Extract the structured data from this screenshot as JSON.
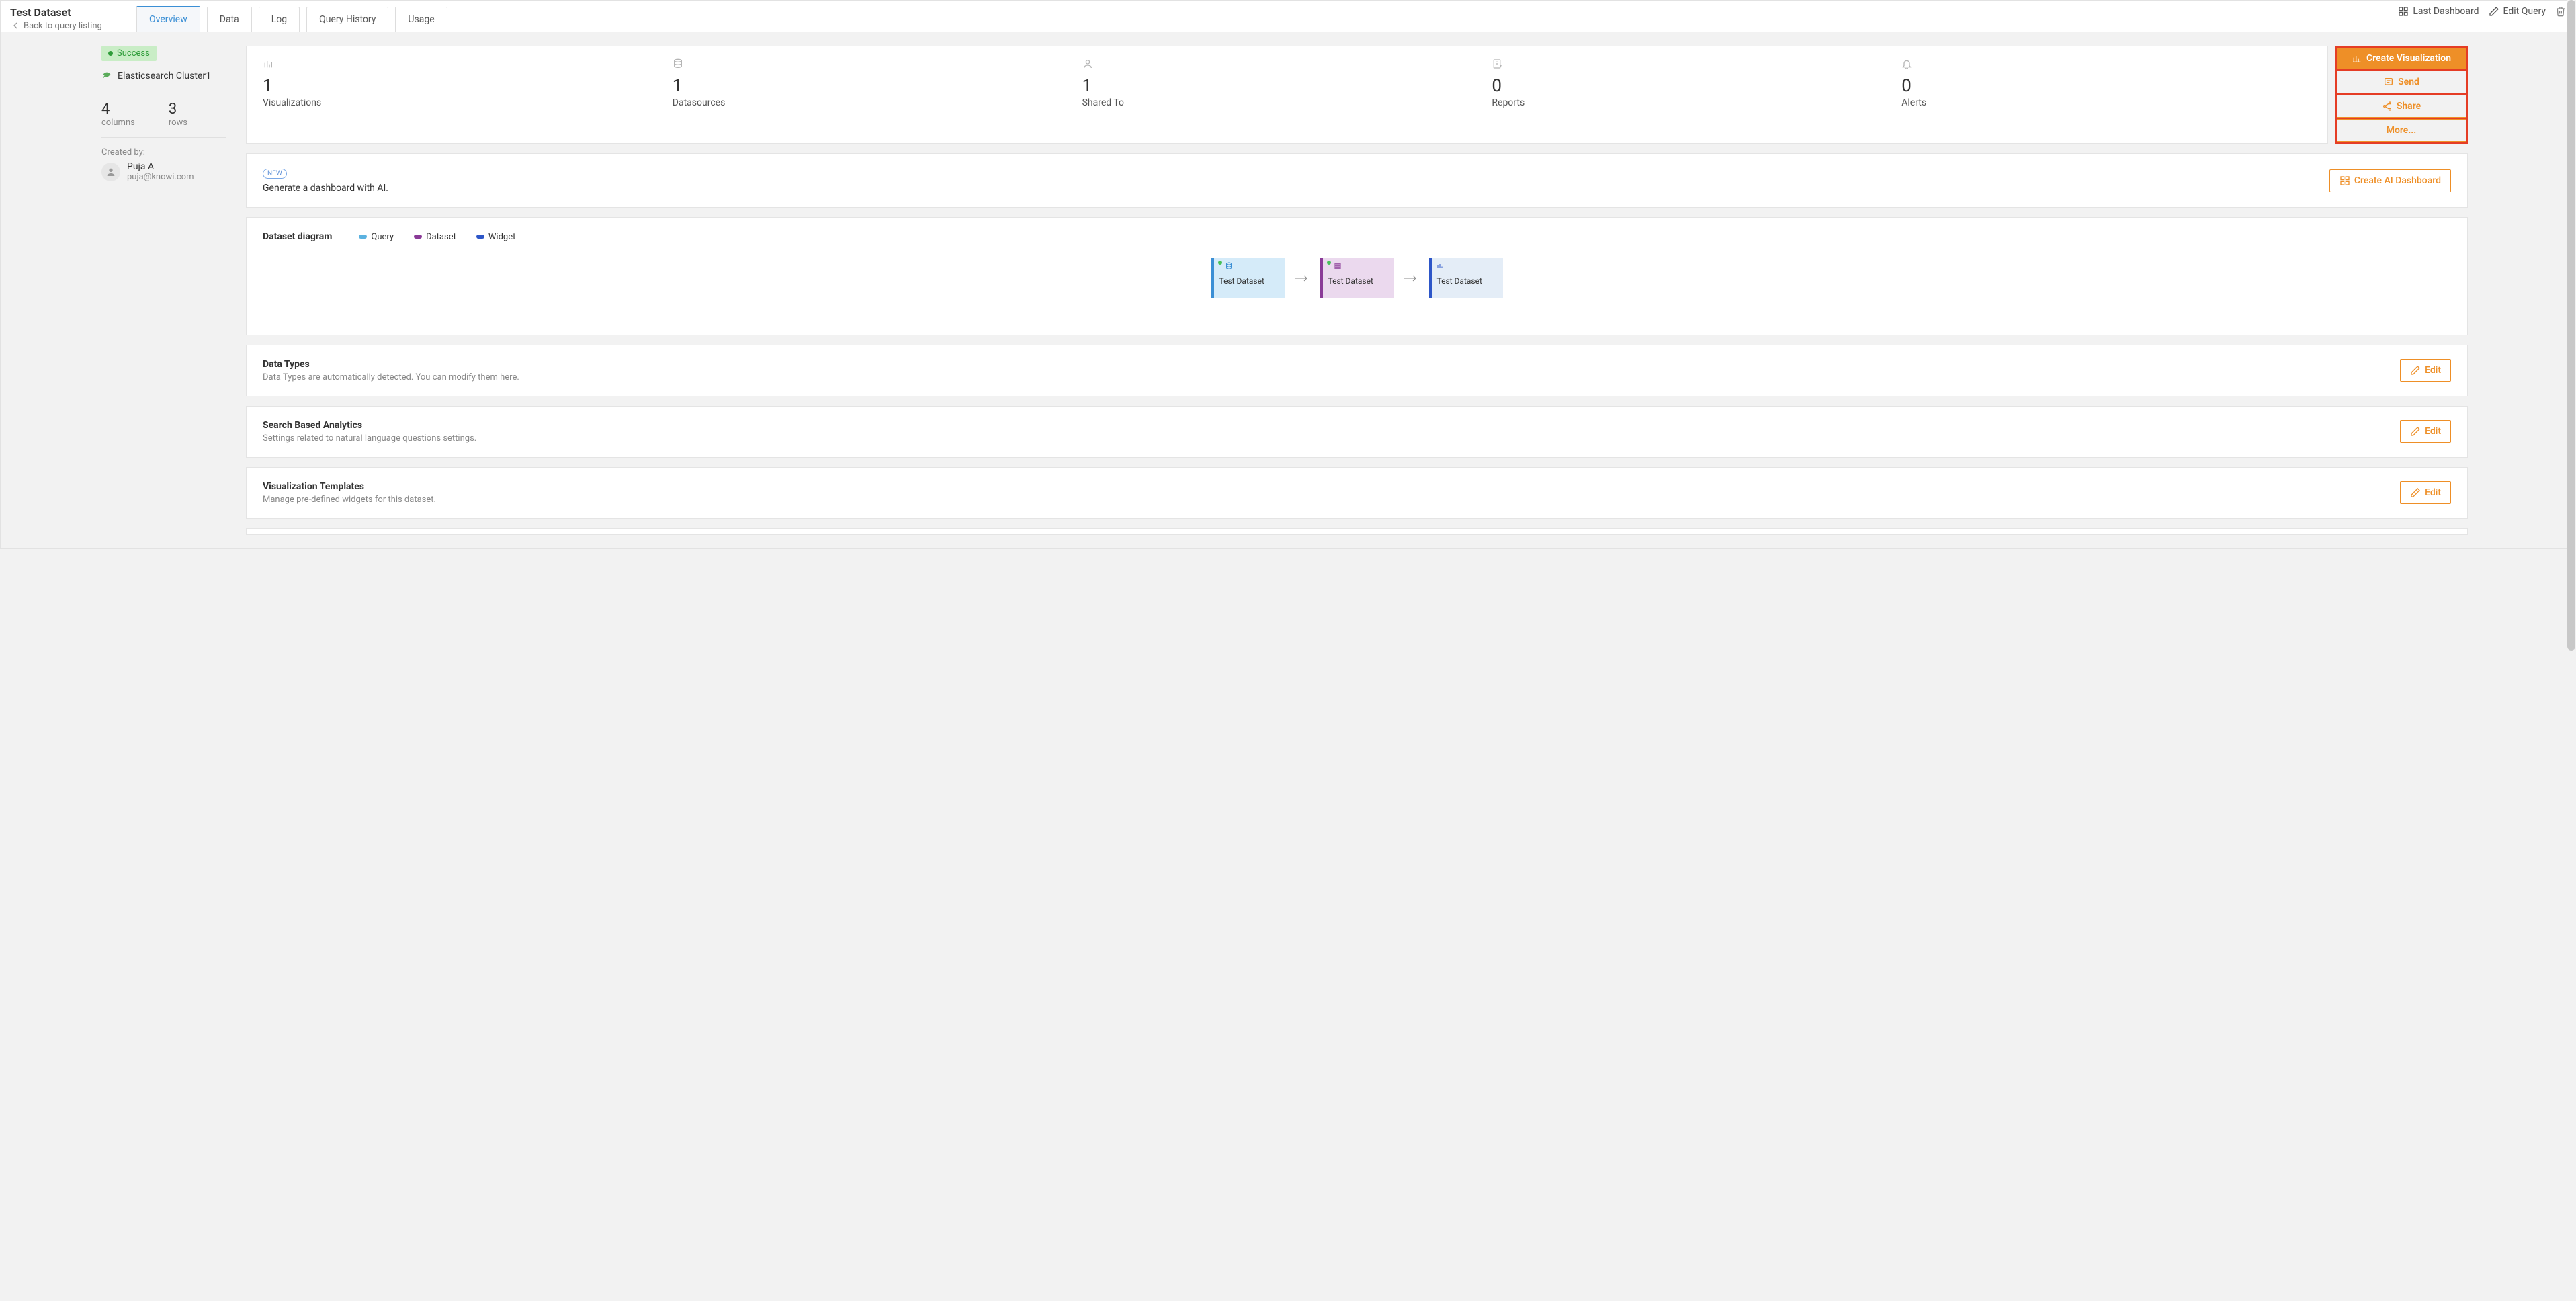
{
  "header": {
    "title": "Test Dataset",
    "back_label": "Back to query listing",
    "tabs": [
      "Overview",
      "Data",
      "Log",
      "Query History",
      "Usage"
    ],
    "last_dashboard": "Last Dashboard",
    "edit_query": "Edit Query"
  },
  "sidebar": {
    "status": "Success",
    "datasource": "Elasticsearch Cluster1",
    "columns_value": "4",
    "columns_label": "columns",
    "rows_value": "3",
    "rows_label": "rows",
    "created_by_label": "Created by:",
    "user_name": "Puja A",
    "user_email": "puja@knowi.com"
  },
  "stats": [
    {
      "value": "1",
      "label": "Visualizations"
    },
    {
      "value": "1",
      "label": "Datasources"
    },
    {
      "value": "1",
      "label": "Shared To"
    },
    {
      "value": "0",
      "label": "Reports"
    },
    {
      "value": "0",
      "label": "Alerts"
    }
  ],
  "actions": {
    "create_viz": "Create Visualization",
    "send": "Send",
    "share": "Share",
    "more": "More..."
  },
  "ai": {
    "new_badge": "NEW",
    "text": "Generate a dashboard with AI.",
    "button": "Create AI Dashboard"
  },
  "diagram": {
    "title": "Dataset diagram",
    "legend": {
      "query": "Query",
      "dataset": "Dataset",
      "widget": "Widget"
    },
    "nodes": [
      "Test Dataset",
      "Test Dataset",
      "Test Dataset"
    ]
  },
  "sections": {
    "data_types": {
      "title": "Data Types",
      "sub": "Data Types are automatically detected. You can modify them here.",
      "edit": "Edit"
    },
    "search": {
      "title": "Search Based Analytics",
      "sub": "Settings related to natural language questions settings.",
      "edit": "Edit"
    },
    "viz_templates": {
      "title": "Visualization Templates",
      "sub": "Manage pre-defined widgets for this dataset.",
      "edit": "Edit"
    }
  }
}
